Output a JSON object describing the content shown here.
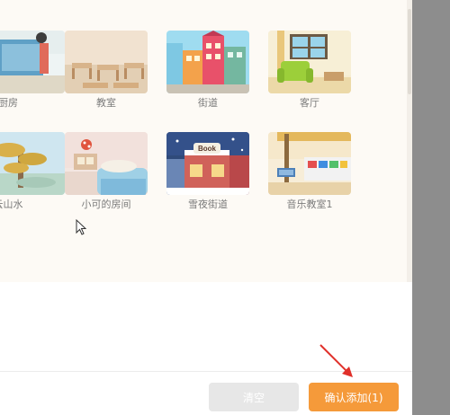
{
  "scenes": [
    {
      "label": "厨房"
    },
    {
      "label": "教室"
    },
    {
      "label": "街道"
    },
    {
      "label": "客厅"
    },
    {
      "label": "云山水"
    },
    {
      "label": "小可的房间"
    },
    {
      "label": "雪夜街道",
      "sign": "Book"
    },
    {
      "label": "音乐教室1"
    }
  ],
  "footer": {
    "clear_label": "清空",
    "confirm_label": "确认添加(1)"
  },
  "colors": {
    "accent": "#f59a3a",
    "panel_bg": "#fdfaf5",
    "clear_bg": "#e7e7e7",
    "annotation_arrow": "#e0302a"
  }
}
